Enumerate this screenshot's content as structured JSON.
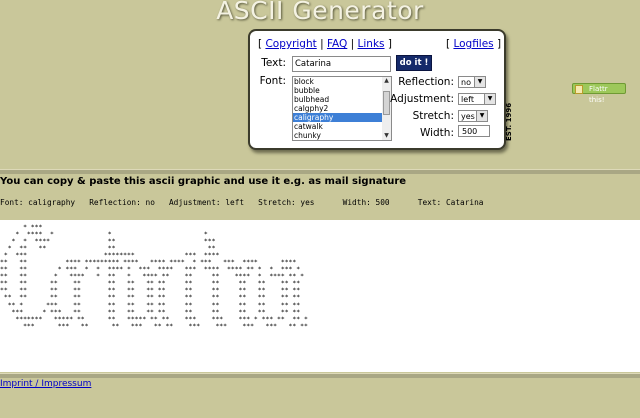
{
  "header": {
    "title": "ASCII Generator"
  },
  "nav": {
    "bracket_open": "[ ",
    "links": [
      "Copyright",
      "FAQ",
      "Links"
    ],
    "separator": " | ",
    "bracket_close": " ]",
    "logfiles": "Logfiles"
  },
  "form": {
    "text_label": "Text:",
    "text_value": "Catarina",
    "submit_label": "do it !",
    "font_label": "Font:",
    "font_options": [
      "block",
      "bubble",
      "bulbhead",
      "calgphy2",
      "caligraphy",
      "catwalk",
      "chunky"
    ],
    "font_selected": "caligraphy",
    "reflection_label": "Reflection:",
    "reflection_value": "no",
    "adjustment_label": "Adjustment:",
    "adjustment_value": "left",
    "stretch_label": "Stretch:",
    "stretch_value": "yes",
    "width_label": "Width:",
    "width_value": "500"
  },
  "side": {
    "est": "EST. 1996",
    "flattr": "Flattr this!"
  },
  "result": {
    "copy_note": "You can copy & paste this ascii graphic and use it e.g. as mail signature",
    "settings_line": "Font: caligraphy   Reflection: no   Adjustment: left   Stretch: yes      Width: 500      Text: Catarina",
    "ascii": "      * ***\n    *  ****  *              *                        *\n   *  *  ****               **                       ***\n  *  **   **                **                        **\n *  ***                    ********             ***  ****\n**   **          **** ********* ****   **** ****  * ***   ***  ****      ****\n**   **        * ***  *  *  **** *  ***  ****   ***  ****  **** ** *  *  *** *\n**   **       *   ****   *  **   *   **** **    **     **    ****  *  **** ** *\n**   **      **    **       **   **   ** **     **     **     **   **    ** **\n**   **      **    **       **   **   ** **     **     **     **   **    ** **\n **  **      **    **       **   **   ** **     **     **     **   **    ** **\n  ** *      ***    **       **   **   ** **     **     **     **   **    ** **\n   ***     * ***   **       **   **   ** **     **     **     **   **    ** **\n    *******   ***** **      **   ***** ** **    ***    ***    *** * *** **  ** *\n      ***      ***   **      **   ***   ** **    ***    ***    ***   ***   ** **"
  },
  "footer": {
    "imprint": "Imprint / Impressum"
  }
}
